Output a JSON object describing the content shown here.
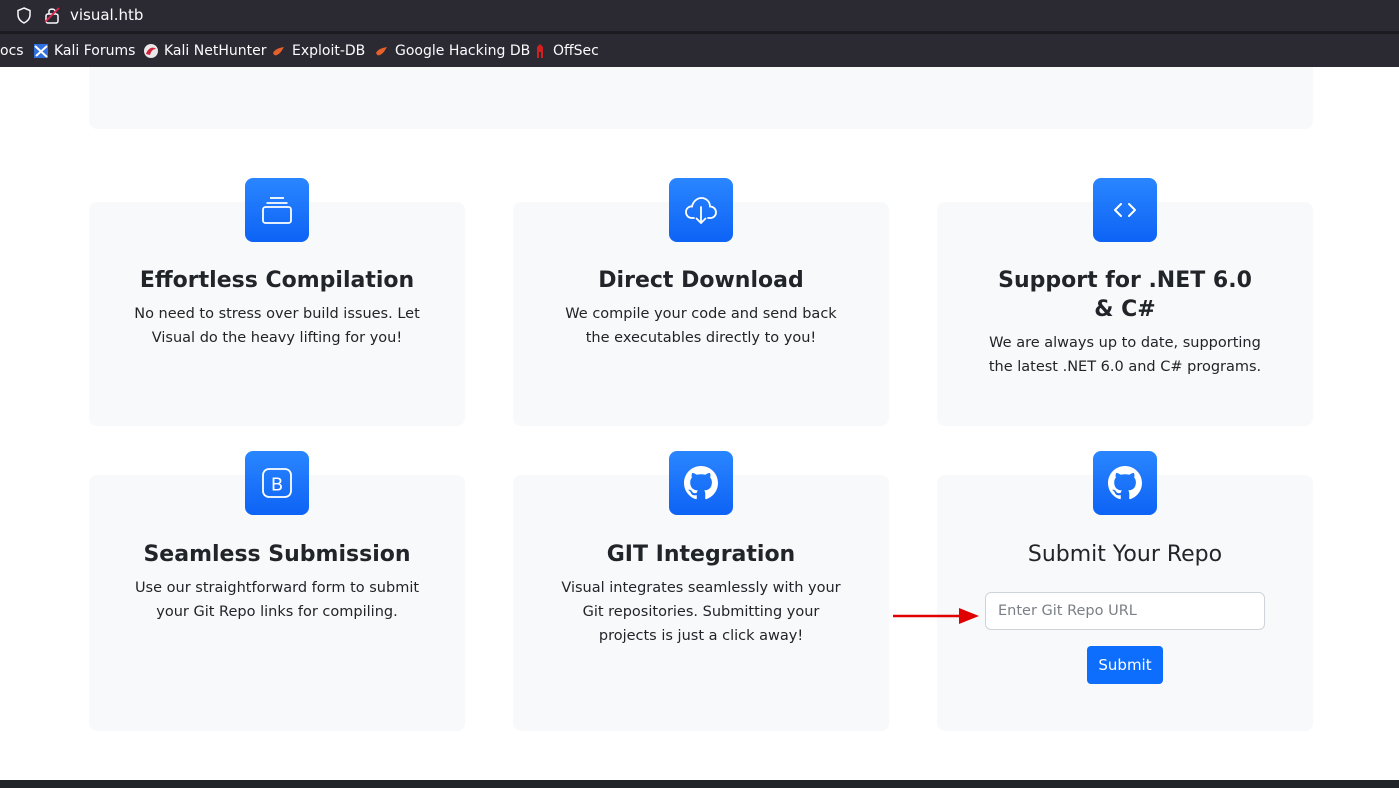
{
  "browser": {
    "url": "visual.htb",
    "bookmarks": [
      {
        "label": "ocs",
        "icon": "doc-icon"
      },
      {
        "label": "Kali Forums",
        "icon": "kali-forums-icon"
      },
      {
        "label": "Kali NetHunter",
        "icon": "nethunter-icon"
      },
      {
        "label": "Exploit-DB",
        "icon": "exploit-db-icon"
      },
      {
        "label": "Google Hacking DB",
        "icon": "ghdb-icon"
      },
      {
        "label": "OffSec",
        "icon": "offsec-icon"
      }
    ]
  },
  "features": [
    {
      "title": "Effortless Compilation",
      "text": "No need to stress over build issues. Let Visual do the heavy lifting for you!",
      "icon": "window-stack-icon"
    },
    {
      "title": "Direct Download",
      "text": "We compile your code and send back the executables directly to you!",
      "icon": "cloud-download-icon"
    },
    {
      "title": "Support for .NET 6.0 & C#",
      "text": "We are always up to date, supporting the latest .NET 6.0 and C# programs.",
      "icon": "code-brackets-icon"
    },
    {
      "title": "Seamless Submission",
      "text": "Use our straightforward form to submit your Git Repo links for compiling.",
      "icon": "bootstrap-icon"
    },
    {
      "title": "GIT Integration",
      "text": "Visual integrates seamlessly with your Git repositories. Submitting your projects is just a click away!",
      "icon": "github-icon"
    }
  ],
  "submit_form": {
    "title": "Submit Your Repo",
    "input_placeholder": "Enter Git Repo URL",
    "input_value": "",
    "button_label": "Submit",
    "icon": "github-icon"
  },
  "colors": {
    "accent": "#0d6efd",
    "card_bg": "#f8f9fa",
    "annotation_arrow": "#e00000"
  }
}
